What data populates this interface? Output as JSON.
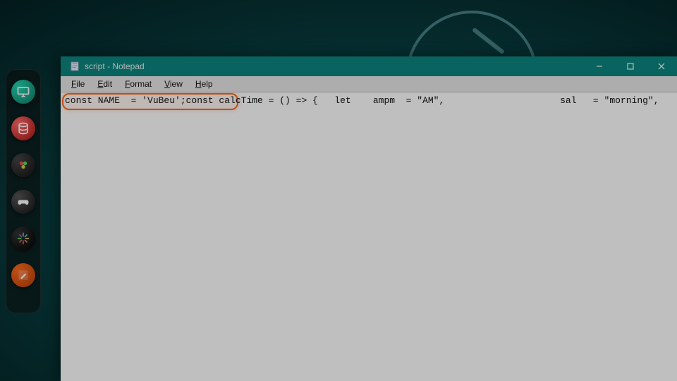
{
  "window": {
    "title": "script - Notepad"
  },
  "menubar": {
    "file": "File",
    "edit": "Edit",
    "format": "Format",
    "view": "View",
    "help": "Help"
  },
  "code": {
    "segment_highlighted": "const NAME  = 'VuBeu'",
    "segment_rest": ";const calcTime = () => {   let    ampm  = \"AM\",                     sal   = \"morning\","
  },
  "dock_icons": [
    "monitor-icon",
    "database-icon",
    "film-icon",
    "gamepad-icon",
    "spark-icon",
    "pen-square-icon"
  ],
  "colors": {
    "titlebar": "#0d8680",
    "highlight": "#ff6a1f"
  }
}
